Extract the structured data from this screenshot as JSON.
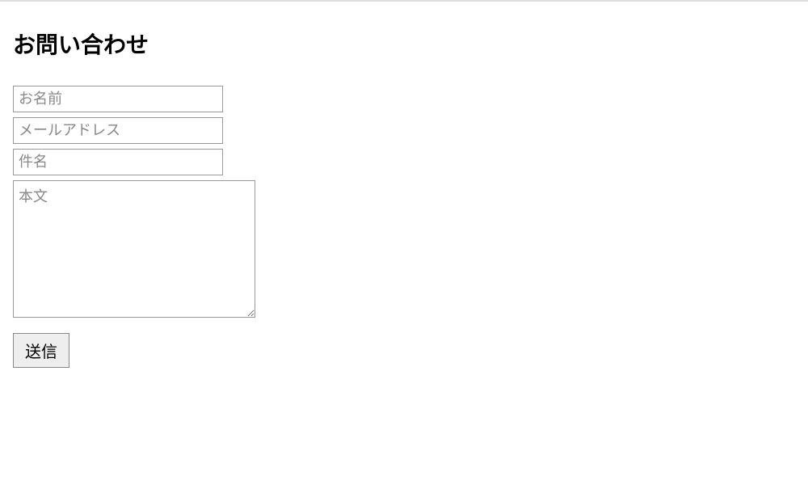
{
  "heading": "お問い合わせ",
  "form": {
    "name_placeholder": "お名前",
    "email_placeholder": "メールアドレス",
    "subject_placeholder": "件名",
    "body_placeholder": "本文",
    "submit_label": "送信"
  }
}
